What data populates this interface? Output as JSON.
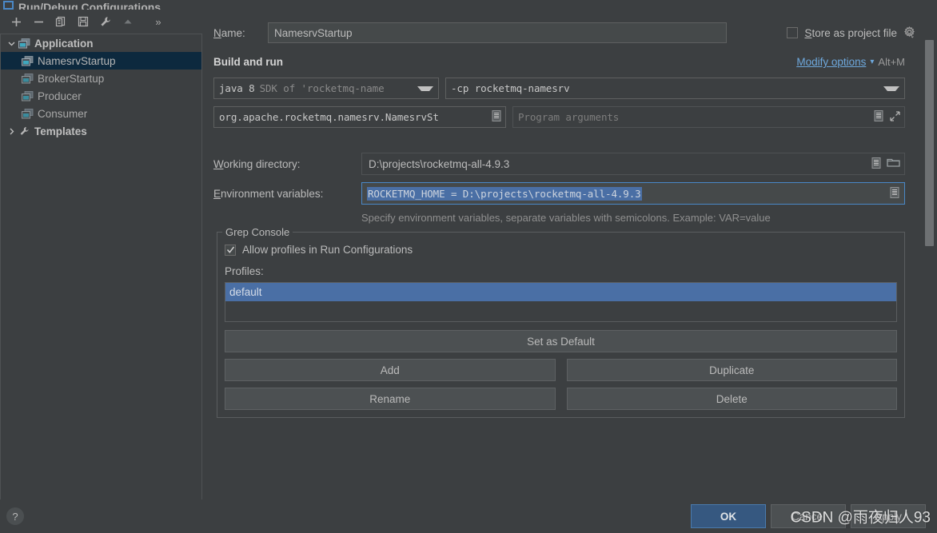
{
  "window": {
    "title": "Run/Debug Configurations",
    "icon": "run-debug-configurations-icon"
  },
  "toolbar": {
    "buttons": [
      {
        "name": "add-configuration-button",
        "icon": "plus-icon"
      },
      {
        "name": "remove-configuration-button",
        "icon": "minus-icon"
      },
      {
        "name": "copy-configuration-button",
        "icon": "copy-icon"
      },
      {
        "name": "save-configuration-button",
        "icon": "save-icon"
      },
      {
        "name": "edit-templates-button",
        "icon": "wrench-icon"
      },
      {
        "name": "move-up-button",
        "icon": "arrow-up-icon"
      }
    ],
    "overflow_label": "»"
  },
  "tree": {
    "groups": [
      {
        "label": "Application",
        "expanded": true,
        "icon": "application-icon",
        "items": [
          {
            "label": "NamesrvStartup",
            "icon": "application-icon",
            "selected": true
          },
          {
            "label": "BrokerStartup",
            "icon": "application-icon",
            "selected": false
          },
          {
            "label": "Producer",
            "icon": "application-icon",
            "selected": false
          },
          {
            "label": "Consumer",
            "icon": "application-icon",
            "selected": false
          }
        ]
      }
    ],
    "templates": {
      "label": "Templates",
      "expanded": false,
      "icon": "wrench-icon"
    }
  },
  "form": {
    "name_label": "Name:",
    "name_value": "NamesrvStartup",
    "name_placeholder": "",
    "store_as_project_file_label": "Store as project file",
    "store_as_project_file_checked": false,
    "store_gear_icon": "gear-icon",
    "section_title": "Build and run",
    "modify_options_label": "Modify options",
    "modify_options_shortcut": "Alt+M",
    "sdk_value_bold": "java 8",
    "sdk_value_dim": "SDK of 'rocketmq-name",
    "classpath_value": "-cp rocketmq-namesrv",
    "main_class_value": "org.apache.rocketmq.namesrv.NamesrvSt",
    "program_arguments_placeholder": "Program arguments",
    "working_directory_label": "Working directory:",
    "working_directory_value": "D:\\projects\\rocketmq-all-4.9.3",
    "environment_variables_label": "Environment variables:",
    "environment_variables_value": "ROCKETMQ_HOME = D:\\projects\\rocketmq-all-4.9.3",
    "environment_hint": "Specify environment variables, separate variables with semicolons. Example: VAR=value",
    "icons": {
      "macro": "macro-icon",
      "browse_folder": "folder-icon",
      "expand": "expand-icon",
      "combo_arrow": "chevron-down-icon"
    }
  },
  "grep_console": {
    "group_title": "Grep Console",
    "allow_profiles_label": "Allow profiles in Run Configurations",
    "allow_profiles_checked": true,
    "profiles_label": "Profiles:",
    "profiles": [
      {
        "label": "default",
        "selected": true
      }
    ],
    "buttons": {
      "set_as_default": "Set as Default",
      "add": "Add",
      "duplicate": "Duplicate",
      "rename": "Rename",
      "delete": "Delete"
    }
  },
  "footer": {
    "help_label": "?",
    "help_icon": "help-icon",
    "ok_label": "OK",
    "cancel_label": "Cancel",
    "apply_label": "Apply"
  },
  "watermark": {
    "text": "CSDN @雨夜归人93"
  },
  "colors": {
    "background": "#3c3f41",
    "accent_link": "#6ea8dc",
    "selection_blue": "#4a6fa5",
    "tree_selection": "#0d293e",
    "primary_button": "#365880",
    "field_background": "#45494a",
    "border": "#5e6060"
  }
}
